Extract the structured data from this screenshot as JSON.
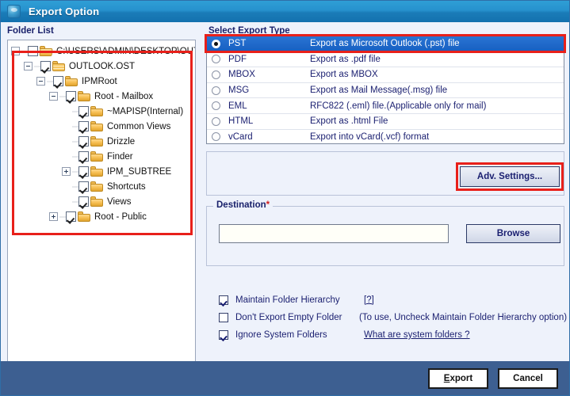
{
  "window": {
    "title": "Export Option",
    "icon": "app-icon"
  },
  "left_panel": {
    "section_label": "Folder List",
    "tree": [
      {
        "label": "C:\\USERS\\ADMIN\\DESKTOP\\OUTL(",
        "depth": 0,
        "twisty": "minus",
        "checked": false,
        "folder": "open"
      },
      {
        "label": "OUTLOOK.OST",
        "depth": 1,
        "twisty": "minus",
        "checked": true,
        "folder": "doc"
      },
      {
        "label": "IPMRoot",
        "depth": 2,
        "twisty": "minus",
        "checked": true,
        "folder": "closed"
      },
      {
        "label": "Root - Mailbox",
        "depth": 3,
        "twisty": "minus",
        "checked": true,
        "folder": "closed"
      },
      {
        "label": "~MAPISP(Internal)",
        "depth": 4,
        "twisty": "none",
        "checked": true,
        "folder": "closed"
      },
      {
        "label": "Common Views",
        "depth": 4,
        "twisty": "none",
        "checked": true,
        "folder": "closed"
      },
      {
        "label": "Drizzle",
        "depth": 4,
        "twisty": "none",
        "checked": true,
        "folder": "closed"
      },
      {
        "label": "Finder",
        "depth": 4,
        "twisty": "none",
        "checked": true,
        "folder": "closed"
      },
      {
        "label": "IPM_SUBTREE",
        "depth": 4,
        "twisty": "plus",
        "checked": true,
        "folder": "closed"
      },
      {
        "label": "Shortcuts",
        "depth": 4,
        "twisty": "none",
        "checked": true,
        "folder": "closed"
      },
      {
        "label": "Views",
        "depth": 4,
        "twisty": "none",
        "checked": true,
        "folder": "closed"
      },
      {
        "label": "Root - Public",
        "depth": 3,
        "twisty": "plus",
        "checked": true,
        "folder": "closed"
      }
    ],
    "scrollbar": {
      "left_arrow": "❮",
      "right_arrow": "❯"
    }
  },
  "right_panel": {
    "export_type": {
      "legend": "Select Export Type",
      "rows": [
        {
          "name": "PST",
          "desc": "Export as Microsoft Outlook (.pst) file",
          "selected": true
        },
        {
          "name": "PDF",
          "desc": "Export as .pdf file",
          "selected": false
        },
        {
          "name": "MBOX",
          "desc": "Export as MBOX",
          "selected": false
        },
        {
          "name": "MSG",
          "desc": "Export as Mail Message(.msg) file",
          "selected": false
        },
        {
          "name": "EML",
          "desc": "RFC822 (.eml) file.(Applicable only for mail)",
          "selected": false
        },
        {
          "name": "HTML",
          "desc": "Export as .html File",
          "selected": false
        },
        {
          "name": "vCard",
          "desc": "Export into vCard(.vcf) format",
          "selected": false
        }
      ]
    },
    "adv_settings_label": "Adv. Settings...",
    "destination": {
      "legend": "Destination",
      "required_marker": "*",
      "input_value": "",
      "input_placeholder": "",
      "browse_label": "Browse"
    },
    "options": [
      {
        "label": "Maintain Folder Hierarchy",
        "checked": true,
        "hint": "[?]",
        "hint_kind": "link"
      },
      {
        "label": "Don't Export Empty Folder",
        "checked": false,
        "hint": "(To use, Uncheck Maintain Folder Hierarchy option)",
        "hint_kind": "text"
      },
      {
        "label": "Ignore System Folders",
        "checked": true,
        "hint": "What are system folders ?",
        "hint_kind": "link"
      }
    ]
  },
  "footer": {
    "export_accel": "E",
    "export_rest": "xport",
    "cancel_label": "Cancel"
  },
  "colors": {
    "title_bar_top": "#2f9fd6",
    "title_bar_bottom": "#1371ae",
    "selection_blue": "#1f6ccb",
    "annotation_red": "#e8201a",
    "footer_blue": "#3d5f91",
    "panel_bg": "#eef2fb",
    "label_navy": "#19216b"
  }
}
